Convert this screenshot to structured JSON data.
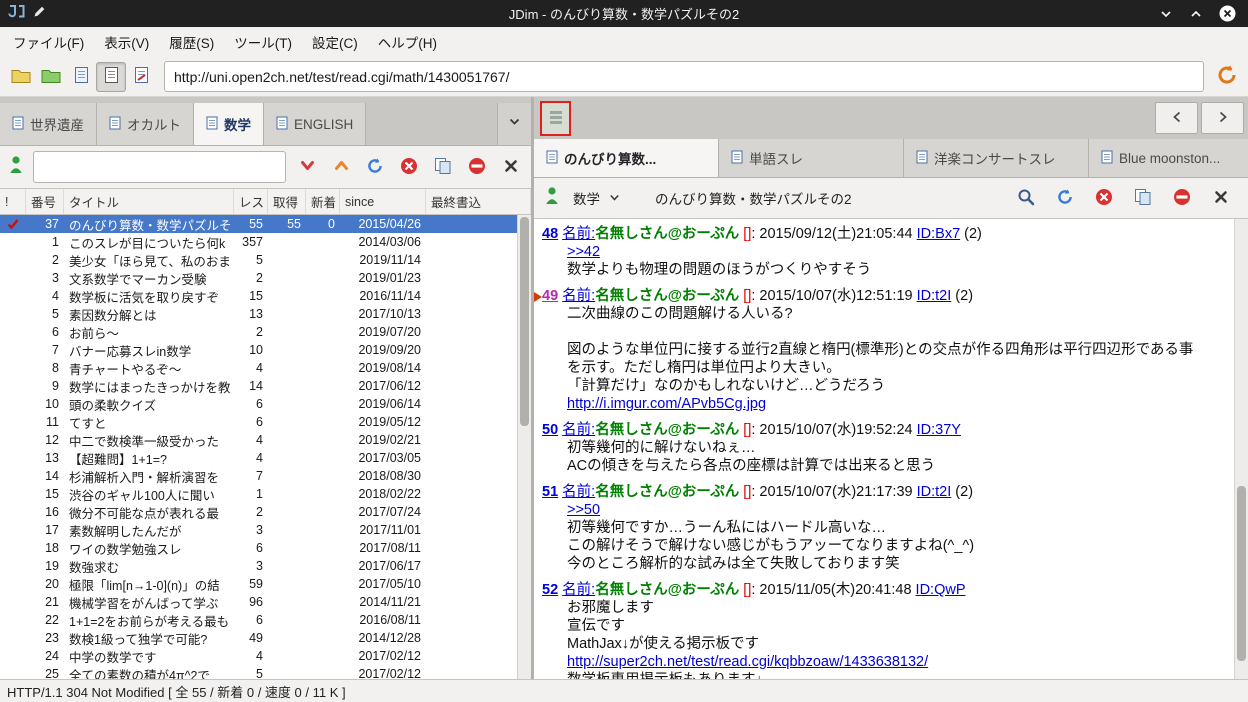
{
  "window": {
    "title": "JDim - のんびり算数・数学パズルその2"
  },
  "menubar": {
    "items": [
      "ファイル(F)",
      "表示(V)",
      "履歴(S)",
      "ツール(T)",
      "設定(C)",
      "ヘルプ(H)"
    ]
  },
  "toolbar": {
    "url": "http://uni.open2ch.net/test/read.cgi/math/1430051767/"
  },
  "board_tabs": [
    {
      "label": "世界遺産"
    },
    {
      "label": "オカルト"
    },
    {
      "label": "数学"
    },
    {
      "label": "ENGLISH"
    }
  ],
  "thread_list": {
    "headers": {
      "mark": "!",
      "num": "番号",
      "title": "タイトル",
      "res": "レス",
      "got": "取得",
      "new": "新着",
      "since": "since",
      "last": "最終書込"
    },
    "rows": [
      {
        "mark": "check",
        "num": "37",
        "title": "のんびり算数・数学パズルそ",
        "res": "55",
        "got": "55",
        "new": "0",
        "since": "2015/04/26",
        "selected": true
      },
      {
        "num": "1",
        "title": "このスレが目についたら何k",
        "res": "357",
        "since": "2014/03/06"
      },
      {
        "num": "2",
        "title": "美少女「ほら見て、私のおま",
        "res": "5",
        "since": "2019/11/14"
      },
      {
        "num": "3",
        "title": "文系数学でマーカン受験",
        "res": "2",
        "since": "2019/01/23"
      },
      {
        "num": "4",
        "title": "数学板に活気を取り戻すぞ",
        "res": "15",
        "since": "2016/11/14"
      },
      {
        "num": "5",
        "title": "素因数分解とは",
        "res": "13",
        "since": "2017/10/13"
      },
      {
        "num": "6",
        "title": "お前ら〜",
        "res": "2",
        "since": "2019/07/20"
      },
      {
        "num": "7",
        "title": "バナー応募スレin数学",
        "res": "10",
        "since": "2019/09/20"
      },
      {
        "num": "8",
        "title": "青チャートやるぞ〜",
        "res": "4",
        "since": "2019/08/14"
      },
      {
        "num": "9",
        "title": "数学にはまったきっかけを教",
        "res": "14",
        "since": "2017/06/12"
      },
      {
        "num": "10",
        "title": "頭の柔軟クイズ",
        "res": "6",
        "since": "2019/06/14"
      },
      {
        "num": "11",
        "title": "てすと",
        "res": "6",
        "since": "2019/05/12"
      },
      {
        "num": "12",
        "title": "中二で数検準一級受かった",
        "res": "4",
        "since": "2019/02/21"
      },
      {
        "num": "13",
        "title": "【超難問】1+1=?",
        "res": "4",
        "since": "2017/03/05"
      },
      {
        "num": "14",
        "title": "杉浦解析入門・解析演習を",
        "res": "7",
        "since": "2018/08/30"
      },
      {
        "num": "15",
        "title": "渋谷のギャル100人に聞い",
        "res": "1",
        "since": "2018/02/22"
      },
      {
        "num": "16",
        "title": "微分不可能な点が表れる最",
        "res": "2",
        "since": "2017/07/24"
      },
      {
        "num": "17",
        "title": "素数解明したんだが",
        "res": "3",
        "since": "2017/11/01"
      },
      {
        "num": "18",
        "title": "ワイの数学勉強スレ",
        "res": "6",
        "since": "2017/08/11"
      },
      {
        "num": "19",
        "title": "数強求む",
        "res": "3",
        "since": "2017/06/17"
      },
      {
        "num": "20",
        "title": "極限「lim[n→1-0](n)」の結",
        "res": "59",
        "since": "2017/05/10"
      },
      {
        "num": "21",
        "title": "機械学習をがんばって学ぶ",
        "res": "96",
        "since": "2014/11/21"
      },
      {
        "num": "22",
        "title": "1+1=2をお前らが考える最も",
        "res": "6",
        "since": "2016/08/11"
      },
      {
        "num": "23",
        "title": "数検1級って独学で可能?",
        "res": "49",
        "since": "2014/12/28"
      },
      {
        "num": "24",
        "title": "中学の数学です",
        "res": "4",
        "since": "2017/02/12"
      },
      {
        "num": "25",
        "title": "全ての素数の積が4π^2で",
        "res": "5",
        "since": "2017/02/12"
      }
    ]
  },
  "thread_tabs": [
    {
      "label": "のんびり算数...",
      "active": true
    },
    {
      "label": "単語スレ"
    },
    {
      "label": "洋楽コンサートスレ"
    },
    {
      "label": "Blue moonston..."
    }
  ],
  "thread_view": {
    "board_name": "数学",
    "title": "のんびり算数・数学パズルその2",
    "posts": [
      {
        "num": "48",
        "name_label": "名前:",
        "name": "名無しさん@おーぷん",
        "mail": "[]",
        "date": "2015/09/12(土)21:05:44",
        "id": "ID:Bx7",
        "count": "(2)",
        "lines": [
          {
            "type": "link",
            "text": ">>42"
          },
          {
            "type": "text",
            "text": "数学よりも物理の問題のほうがつくりやすそう"
          }
        ]
      },
      {
        "num": "49",
        "marker": true,
        "visited": true,
        "name_label": "名前:",
        "name": "名無しさん@おーぷん",
        "mail": "[]",
        "date": "2015/10/07(水)12:51:19",
        "id": "ID:t2I",
        "count": "(2)",
        "lines": [
          {
            "type": "text",
            "text": "二次曲線のこの問題解ける人いる?"
          },
          {
            "type": "text",
            "text": ""
          },
          {
            "type": "text",
            "text": "図のような単位円に接する並行2直線と楕円(標準形)との交点が作る四角形は平行四辺形である事"
          },
          {
            "type": "text",
            "text": "を示す。ただし楕円は単位円より大きい。"
          },
          {
            "type": "text",
            "text": "「計算だけ」なのかもしれないけど…どうだろう"
          },
          {
            "type": "link",
            "text": "http://i.imgur.com/APvb5Cg.jpg"
          }
        ]
      },
      {
        "num": "50",
        "name_label": "名前:",
        "name": "名無しさん@おーぷん",
        "mail": "[]",
        "date": "2015/10/07(水)19:52:24",
        "id": "ID:37Y",
        "count": "",
        "lines": [
          {
            "type": "text",
            "text": "初等幾何的に解けないねぇ…"
          },
          {
            "type": "text",
            "text": "ACの傾きを与えたら各点の座標は計算では出来ると思う"
          }
        ]
      },
      {
        "num": "51",
        "name_label": "名前:",
        "name": "名無しさん@おーぷん",
        "mail": "[]",
        "date": "2015/10/07(水)21:17:39",
        "id": "ID:t2I",
        "count": "(2)",
        "lines": [
          {
            "type": "link",
            "text": ">>50"
          },
          {
            "type": "text",
            "text": "初等幾何ですか…うーん私にはハードル高いな…"
          },
          {
            "type": "text",
            "text": "この解けそうで解けない感じがもうアッーてなりますよね(^_^)"
          },
          {
            "type": "text",
            "text": "今のところ解析的な試みは全て失敗しております笑"
          }
        ]
      },
      {
        "num": "52",
        "name_label": "名前:",
        "name": "名無しさん@おーぷん",
        "mail": "[]",
        "date": "2015/11/05(木)20:41:48",
        "id": "ID:QwP",
        "count": "",
        "lines": [
          {
            "type": "text",
            "text": "お邪魔します"
          },
          {
            "type": "text",
            "text": "宣伝です"
          },
          {
            "type": "text",
            "text": "MathJax↓が使える掲示板です"
          },
          {
            "type": "link",
            "text": "http://super2ch.net/test/read.cgi/kqbbzoaw/1433638132/"
          },
          {
            "type": "text",
            "text": "数学板専用掲示板もあります↓"
          }
        ]
      }
    ]
  },
  "statusbar": {
    "text": "HTTP/1.1 304 Not Modified [ 全 55 / 新着 0 / 速度 0 / 11 K ]"
  }
}
